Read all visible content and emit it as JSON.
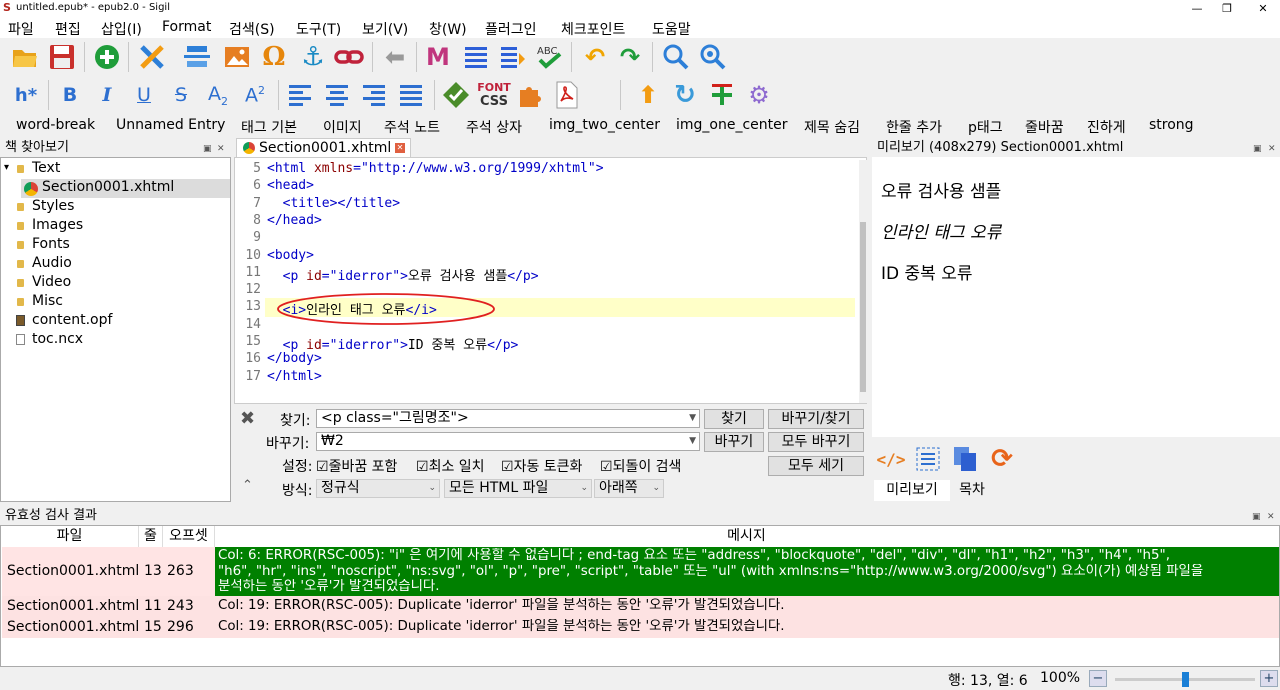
{
  "window": {
    "title": "untitled.epub* - epub2.0 - Sigil",
    "min": "—",
    "max": "❐",
    "close": "✕"
  },
  "menu": [
    "파일",
    "편집",
    "삽입(I)",
    "Format",
    "검색(S)",
    "도구(T)",
    "보기(V)",
    "창(W)",
    "플러그인",
    "체크포인트",
    "도움말"
  ],
  "toolbar2": {
    "heading_label": "h*",
    "font_label_1": "FONT",
    "font_label_2": "CSS"
  },
  "clips": [
    "word-break",
    "Unnamed Entry",
    "태그 기본",
    "이미지",
    "주석 노트",
    "주석 상자",
    "img_two_center",
    "img_one_center",
    "제목 숨김",
    "한줄 추가",
    "p태그",
    "줄바꿈",
    "진하게",
    "strong"
  ],
  "book_browser": {
    "title": "책 찾아보기",
    "items": [
      {
        "label": "Text",
        "level": 0
      },
      {
        "label": "Section0001.xhtml",
        "level": 1
      },
      {
        "label": "Styles",
        "level": 0
      },
      {
        "label": "Images",
        "level": 0
      },
      {
        "label": "Fonts",
        "level": 0
      },
      {
        "label": "Audio",
        "level": 0
      },
      {
        "label": "Video",
        "level": 0
      },
      {
        "label": "Misc",
        "level": 0
      },
      {
        "label": "content.opf",
        "level": 0
      },
      {
        "label": "toc.ncx",
        "level": 0
      }
    ]
  },
  "editor": {
    "tab_label": "Section0001.xhtml",
    "lines": [
      {
        "n": "5",
        "parts": [
          [
            "tg",
            "<html "
          ],
          [
            "at",
            "xmlns"
          ],
          [
            "tg",
            "="
          ],
          [
            "vl",
            "\"http://www.w3.org/1999/xhtml\""
          ],
          [
            "tg",
            ">"
          ]
        ]
      },
      {
        "n": "6",
        "parts": [
          [
            "tg",
            "<head>"
          ]
        ]
      },
      {
        "n": "7",
        "parts": [
          [
            "tg",
            "  <title></title>"
          ]
        ]
      },
      {
        "n": "8",
        "parts": [
          [
            "tg",
            "</head>"
          ]
        ]
      },
      {
        "n": "9",
        "parts": []
      },
      {
        "n": "10",
        "parts": [
          [
            "tg",
            "<body>"
          ]
        ]
      },
      {
        "n": "11",
        "parts": [
          [
            "tg",
            "  <p "
          ],
          [
            "at",
            "id"
          ],
          [
            "tg",
            "="
          ],
          [
            "vl",
            "\"iderror\""
          ],
          [
            "tg",
            ">"
          ],
          [
            "tx",
            "오류 검사용 샘플"
          ],
          [
            "tg",
            "</p>"
          ]
        ]
      },
      {
        "n": "12",
        "parts": []
      },
      {
        "n": "13",
        "parts": [
          [
            "tg",
            "  <i>"
          ],
          [
            "tx",
            "인라인 태그 오류"
          ],
          [
            "tg",
            "</i>"
          ]
        ]
      },
      {
        "n": "14",
        "parts": []
      },
      {
        "n": "15",
        "parts": [
          [
            "tg",
            "  <p "
          ],
          [
            "at",
            "id"
          ],
          [
            "tg",
            "="
          ],
          [
            "vl",
            "\"iderror\""
          ],
          [
            "tg",
            ">"
          ],
          [
            "tx",
            "ID 중복 오류"
          ],
          [
            "tg",
            "</p>"
          ]
        ]
      },
      {
        "n": "16",
        "parts": [
          [
            "tg",
            "</body>"
          ]
        ]
      },
      {
        "n": "17",
        "parts": [
          [
            "tg",
            "</html>"
          ]
        ]
      }
    ]
  },
  "preview": {
    "title": "미리보기 (408x279) Section0001.xhtml",
    "paragraphs": [
      "오류 검사용 샘플",
      "인라인 태그 오류",
      "ID 중복 오류"
    ],
    "tabs": [
      "미리보기",
      "목차"
    ]
  },
  "find_replace": {
    "find_label": "찾기:",
    "find_value": "<p class=\"그림명조\">",
    "replace_label": "바꾸기:",
    "replace_value": "₩2",
    "options_label": "설정:",
    "mode_label": "방식:",
    "checks": [
      "줄바꿈 포함",
      "최소 일치",
      "자동 토큰화",
      "되돌이 검색"
    ],
    "mode": "정규식",
    "target": "모든 HTML 파일",
    "direction": "아래쪽",
    "btn_find": "찾기",
    "btn_replace_find": "바꾸기/찾기",
    "btn_replace": "바꾸기",
    "btn_replace_all": "모두 바꾸기",
    "btn_count": "모두 세기"
  },
  "validation": {
    "title": "유효성 검사 결과",
    "headers": [
      "파일",
      "줄",
      "오프셋",
      "메시지"
    ],
    "rows": [
      {
        "file": "Section0001.xhtml",
        "line": "13",
        "offset": "263",
        "msg": [
          "Col: 6: ERROR(RSC-005): \"i\" 은 여기에 사용할 수 없습니다 ; end-tag 요소 또는 \"address\", \"blockquote\", \"del\", \"div\", \"dl\", \"h1\", \"h2\", \"h3\", \"h4\", \"h5\",",
          "\"h6\", \"hr\", \"ins\", \"noscript\", \"ns:svg\", \"ol\", \"p\", \"pre\", \"script\", \"table\" 또는 \"ul\" (with xmlns:ns=\"http://www.w3.org/2000/svg\") 요소이(가) 예상됨 파일을",
          "분석하는 동안 '오류'가 발견되었습니다."
        ]
      },
      {
        "file": "Section0001.xhtml",
        "line": "11",
        "offset": "243",
        "msg": [
          "Col: 19: ERROR(RSC-005): Duplicate 'iderror' 파일을 분석하는 동안 '오류'가 발견되었습니다."
        ]
      },
      {
        "file": "Section0001.xhtml",
        "line": "15",
        "offset": "296",
        "msg": [
          "Col: 19: ERROR(RSC-005): Duplicate 'iderror' 파일을 분석하는 동안 '오류'가 발견되었습니다."
        ]
      }
    ]
  },
  "status": {
    "position": "행: 13, 열: 6",
    "zoom": "100%",
    "zoom_level": 0.5,
    "zoom_minus": "−",
    "zoom_plus": "+"
  },
  "colors": {
    "selected_row": "#008000",
    "error_row": "#fde2e2",
    "current_line": "#ffffc8",
    "annotation": "#e02020"
  }
}
